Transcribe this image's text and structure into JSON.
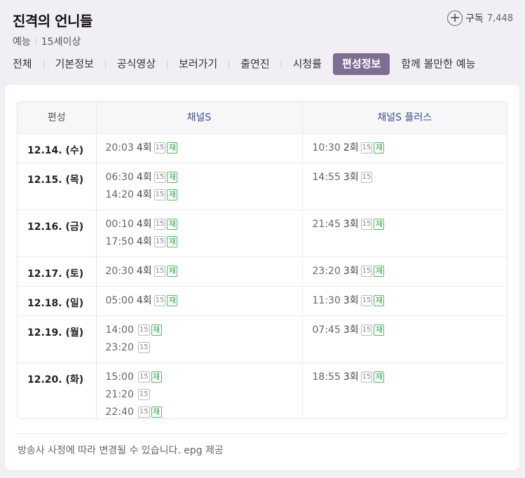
{
  "header": {
    "title": "진격의 언니들",
    "genre": "예능",
    "rating": "15세이상",
    "subscribe_label": "구독",
    "subscribe_count": "7,448"
  },
  "tabs": [
    {
      "label": "전체",
      "active": false
    },
    {
      "label": "기본정보",
      "active": false
    },
    {
      "label": "공식영상",
      "active": false
    },
    {
      "label": "보러가기",
      "active": false
    },
    {
      "label": "출연진",
      "active": false
    },
    {
      "label": "시청률",
      "active": false
    },
    {
      "label": "편성정보",
      "active": true
    },
    {
      "label": "함께 볼만한 예능",
      "active": false
    }
  ],
  "schedule": {
    "headers": {
      "date": "편성",
      "channel1": "채널S",
      "channel2": "채널S 플러스"
    },
    "rows": [
      {
        "date": "12.14. (수)",
        "ch1": [
          {
            "time": "20:03",
            "ep": "4회",
            "age": "15",
            "re": "재"
          }
        ],
        "ch2": [
          {
            "time": "10:30",
            "ep": "2회",
            "age": "15",
            "re": "재"
          }
        ]
      },
      {
        "date": "12.15. (목)",
        "ch1": [
          {
            "time": "06:30",
            "ep": "4회",
            "age": "15",
            "re": "재"
          },
          {
            "time": "14:20",
            "ep": "4회",
            "age": "15",
            "re": "재"
          }
        ],
        "ch2": [
          {
            "time": "14:55",
            "ep": "3회",
            "age": "15",
            "re": ""
          }
        ]
      },
      {
        "date": "12.16. (금)",
        "ch1": [
          {
            "time": "00:10",
            "ep": "4회",
            "age": "15",
            "re": "재"
          },
          {
            "time": "17:50",
            "ep": "4회",
            "age": "15",
            "re": "재"
          }
        ],
        "ch2": [
          {
            "time": "21:45",
            "ep": "3회",
            "age": "15",
            "re": "재"
          }
        ]
      },
      {
        "date": "12.17. (토)",
        "ch1": [
          {
            "time": "20:30",
            "ep": "4회",
            "age": "15",
            "re": "재"
          }
        ],
        "ch2": [
          {
            "time": "23:20",
            "ep": "3회",
            "age": "15",
            "re": "재"
          }
        ]
      },
      {
        "date": "12.18. (일)",
        "ch1": [
          {
            "time": "05:00",
            "ep": "4회",
            "age": "15",
            "re": "재"
          }
        ],
        "ch2": [
          {
            "time": "11:30",
            "ep": "3회",
            "age": "15",
            "re": "재"
          }
        ]
      },
      {
        "date": "12.19. (월)",
        "ch1": [
          {
            "time": "14:00",
            "ep": "",
            "age": "15",
            "re": "재"
          },
          {
            "time": "23:20",
            "ep": "",
            "age": "15",
            "re": ""
          }
        ],
        "ch2": [
          {
            "time": "07:45",
            "ep": "3회",
            "age": "15",
            "re": "재"
          }
        ]
      },
      {
        "date": "12.20. (화)",
        "ch1": [
          {
            "time": "15:00",
            "ep": "",
            "age": "15",
            "re": "재"
          },
          {
            "time": "21:20",
            "ep": "",
            "age": "15",
            "re": ""
          },
          {
            "time": "22:40",
            "ep": "",
            "age": "15",
            "re": "재"
          }
        ],
        "ch2": [
          {
            "time": "18:55",
            "ep": "3회",
            "age": "15",
            "re": "재"
          }
        ]
      }
    ]
  },
  "footer_note": "방송사 사정에 따라 변경될 수 있습니다. epg 제공",
  "colors": {
    "active_tab_bg": "#7e6e93",
    "channel_header": "#3a4f8e",
    "rerun_badge": "#2f9e47"
  }
}
